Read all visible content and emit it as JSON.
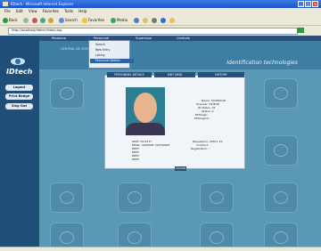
{
  "window": {
    "title": "IDtech - Microsoft Internet Explorer"
  },
  "menubar": {
    "items": [
      "File",
      "Edit",
      "View",
      "Favorites",
      "Tools",
      "Help"
    ]
  },
  "toolbar": {
    "back_label": "Back",
    "search_label": "Search",
    "favorites_label": "Favorites",
    "media_label": "Media"
  },
  "addressbar": {
    "label": "Address",
    "value": "http://localhost/idtech/index.asp"
  },
  "nav": {
    "tabs": [
      "Mudanca",
      "Personnel",
      "Supervisor",
      "Controle"
    ]
  },
  "dropdown": {
    "items": [
      "Search",
      "New Entry",
      "Listing",
      "Personnel Details"
    ],
    "selected": 3
  },
  "banner": {
    "caption": "CENTRAL DE ATENDIMENTO",
    "tagline": "Identification technologies"
  },
  "sidebar": {
    "logo": "IDtech",
    "buttons": [
      "Logout",
      "Print Badge",
      "Sing Out"
    ]
  },
  "panel": {
    "tabs": [
      "PERSONNEL DETAILS",
      "EDIT DATA",
      "HISTORY"
    ],
    "fields_right": [
      {
        "label": "Name:",
        "value": "FJOHNSON"
      },
      {
        "label": "Pinsuser:",
        "value": "FSTEVE"
      },
      {
        "label": "ID Status:",
        "value": "01"
      },
      {
        "label": "Status:",
        "value": "V"
      },
      {
        "label": "EFDlogin:",
        "value": ""
      },
      {
        "label": "EFDlogOut:",
        "value": ""
      }
    ],
    "fields_left": [
      {
        "label": "DEPT:",
        "value": "DT-6717"
      },
      {
        "label": "EMAIL:",
        "value": "SUPPORT SOFTWARE"
      },
      {
        "label": "DEPT:",
        "value": ""
      },
      {
        "label": "DEPT:",
        "value": ""
      },
      {
        "label": "DEPT:",
        "value": ""
      },
      {
        "label": "DEPT:",
        "value": ""
      }
    ],
    "fields_bottom_right": [
      {
        "label": "Requestors:",
        "value": "CHM-1 23"
      },
      {
        "label": "Contract:",
        "value": ""
      },
      {
        "label": "Registration:",
        "value": "-"
      }
    ]
  },
  "footer": {
    "button": "VOLTAR"
  },
  "colors": {
    "sidebar": "#1f4e78",
    "content": "#5a98b4",
    "titlebar": "#1c52c8"
  }
}
